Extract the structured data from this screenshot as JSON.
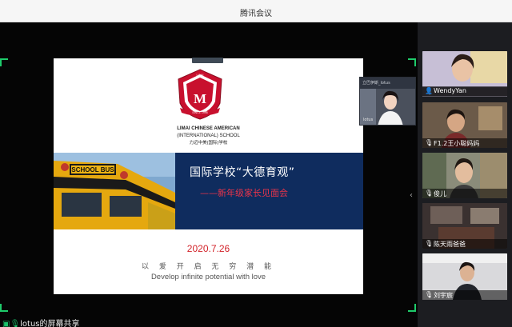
{
  "window": {
    "title": "腾讯会议"
  },
  "slide": {
    "title": "国际学校“大德育观”",
    "subtitle": "——新年级家长见面会",
    "date": "2020.7.26",
    "motto_cn": "以 爱 开 启 无 穷 潜 能",
    "motto_en": "Develop infinite potential with love",
    "school_name_line1": "LIMAI CHINESE AMERICAN",
    "school_name_line2": "(INTERNATIONAL) SCHOOL",
    "school_name_cn": "力迈中美(国际)学校",
    "logo_text": {
      "top": "LCAI",
      "year": "SINCE 1995"
    },
    "bus_text": "SCHOOL BUS"
  },
  "presenter": {
    "name": "立巴伊斯_lotus",
    "mic_label": "lotus"
  },
  "participants": [
    {
      "name": "",
      "mic": "on"
    },
    {
      "name": "WendyYan",
      "mic": "on"
    },
    {
      "name": "F1.2王小聪妈妈",
      "mic": "on"
    },
    {
      "name": "俊儿",
      "mic": "on"
    },
    {
      "name": "陈天雨爸爸",
      "mic": "on"
    },
    {
      "name": "刘宇宸",
      "mic": "on"
    }
  ],
  "status": {
    "share_text": "lotus的屏幕共享"
  },
  "colors": {
    "band": "#0f2c5e",
    "accent_red": "#d2232a",
    "green": "#19c26a"
  }
}
